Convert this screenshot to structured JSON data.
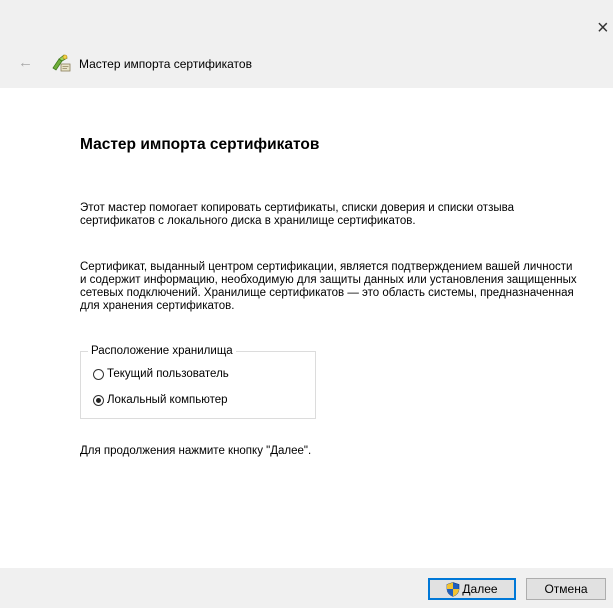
{
  "window": {
    "title": "Мастер импорта сертификатов",
    "close_glyph": "×",
    "back_glyph": "←"
  },
  "content": {
    "heading": "Мастер импорта сертификатов",
    "paragraph1": "Этот мастер помогает копировать сертификаты, списки доверия и списки отзыва сертификатов с локального диска в хранилище сертификатов.",
    "paragraph2": "Сертификат, выданный центром сертификации, является подтверждением вашей личности и содержит информацию, необходимую для защиты данных или установления защищенных сетевых подключений. Хранилище сертификатов — это область системы, предназначенная для хранения сертификатов.",
    "store_location": {
      "legend": "Расположение хранилища",
      "options": [
        {
          "label": "Текущий пользователь",
          "selected": false
        },
        {
          "label": "Локальный компьютер",
          "selected": true
        }
      ]
    },
    "continue_note": "Для продолжения нажмите кнопку \"Далее\"."
  },
  "buttons": {
    "next_label": "Далее",
    "cancel_label": "Отмена"
  },
  "icons": {
    "wizard": "certificate-wizard-icon",
    "shield": "uac-shield-icon",
    "back": "back-arrow-icon",
    "close": "close-icon"
  },
  "colors": {
    "chrome_bg": "#f0f0f0",
    "content_bg": "#ffffff",
    "default_button_border": "#0078d7"
  }
}
